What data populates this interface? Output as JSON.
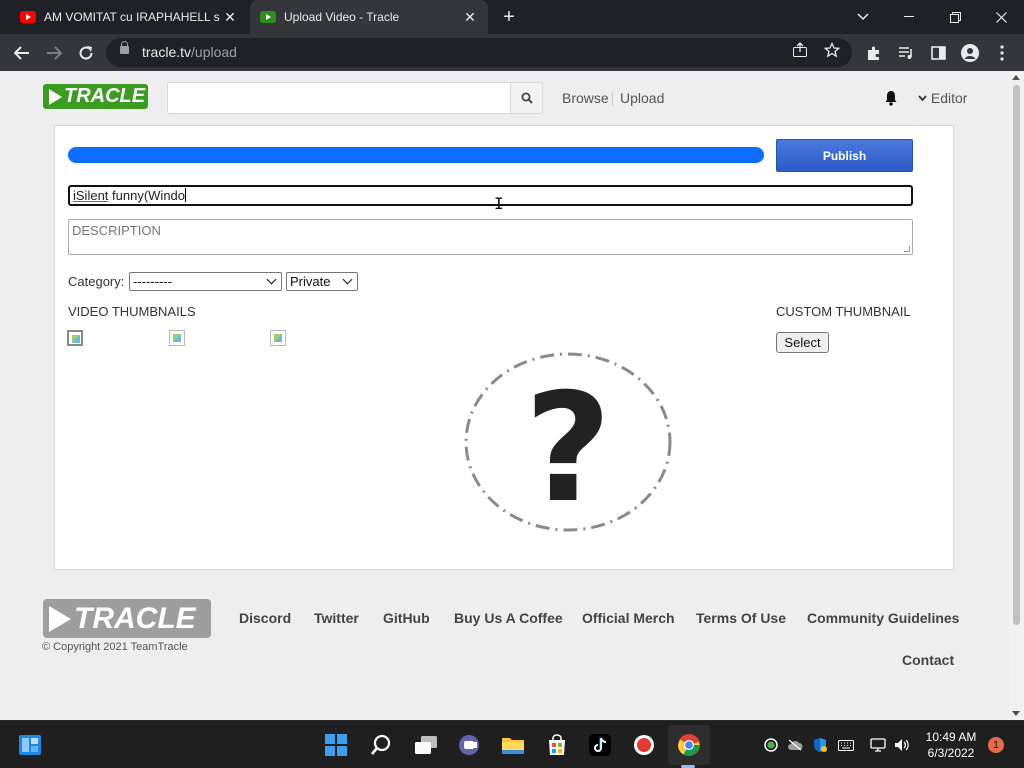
{
  "browser": {
    "tabs": [
      {
        "title": "AM VOMITAT cu IRAPHAHELL si l",
        "favicon": "youtube-icon"
      },
      {
        "title": "Upload Video - Tracle",
        "favicon": "tracle-icon",
        "active": true
      }
    ],
    "url_host": "tracle.tv",
    "url_path": "/upload"
  },
  "header": {
    "logo_text": "TRACLE",
    "search_placeholder": "",
    "nav": [
      "Browse",
      "Upload"
    ],
    "user_menu": "Editor"
  },
  "upload": {
    "progress_percent": 100,
    "publish_label": "Publish",
    "title_value_underlined": "iSilent",
    "title_value_rest": " funny(Windo",
    "description_placeholder": "DESCRIPTION",
    "category_label": "Category:",
    "category_selected": "---------",
    "privacy_selected": "Private",
    "video_thumbnails_label": "VIDEO THUMBNAILS",
    "custom_thumbnail_label": "CUSTOM THUMBNAIL",
    "select_button": "Select"
  },
  "footer": {
    "logo_text": "TRACLE",
    "copyright": "© Copyright 2021 TeamTracle",
    "links": [
      "Discord",
      "Twitter",
      "GitHub",
      "Buy Us A Coffee",
      "Official Merch",
      "Terms Of Use",
      "Community Guidelines",
      "Contact"
    ]
  },
  "taskbar": {
    "time": "10:49 AM",
    "date": "6/3/2022",
    "notification_count": "1"
  },
  "colors": {
    "brand_green": "#3c9c21",
    "progress_blue": "#0d6efd",
    "publish_blue": "#2c5bc4"
  }
}
